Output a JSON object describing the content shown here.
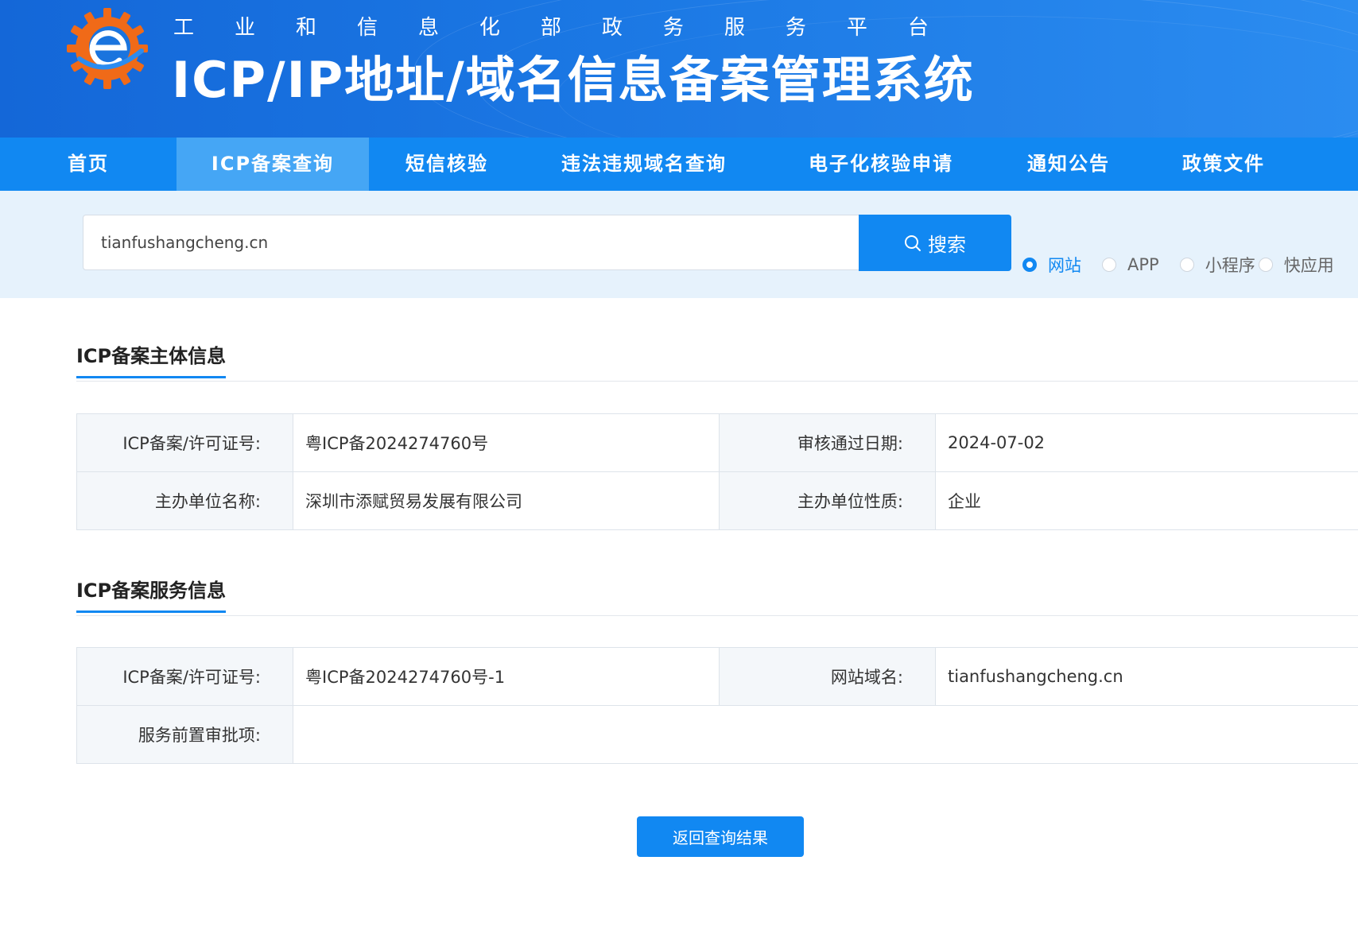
{
  "header": {
    "subtitle_chars": [
      "工",
      "业",
      "和",
      "信",
      "息",
      "化",
      "部",
      "政",
      "务",
      "服",
      "务",
      "平",
      "台"
    ],
    "title": "ICP/IP地址/域名信息备案管理系统",
    "logo_icon": "emblem-gear-e-icon"
  },
  "nav": {
    "items": [
      {
        "label": "首页",
        "active": false
      },
      {
        "label": "ICP备案查询",
        "active": true
      },
      {
        "label": "短信核验",
        "active": false
      },
      {
        "label": "违法违规域名查询",
        "active": false
      },
      {
        "label": "电子化核验申请",
        "active": false
      },
      {
        "label": "通知公告",
        "active": false
      },
      {
        "label": "政策文件",
        "active": false
      }
    ]
  },
  "search": {
    "value": "tianfushangcheng.cn",
    "button_label": "搜索",
    "button_icon": "search-icon",
    "types": [
      {
        "label": "网站",
        "checked": true
      },
      {
        "label": "APP",
        "checked": false
      },
      {
        "label": "小程序",
        "checked": false
      },
      {
        "label": "快应用",
        "checked": false
      }
    ]
  },
  "subject_info": {
    "title": "ICP备案主体信息",
    "license_label": "ICP备案/许可证号:",
    "license_value": "粤ICP备2024274760号",
    "approve_date_label": "审核通过日期:",
    "approve_date_value": "2024-07-02",
    "org_name_label": "主办单位名称:",
    "org_name_value": "深圳市添赋贸易发展有限公司",
    "org_type_label": "主办单位性质:",
    "org_type_value": "企业"
  },
  "service_info": {
    "title": "ICP备案服务信息",
    "license_label": "ICP备案/许可证号:",
    "license_value": "粤ICP备2024274760号-1",
    "domain_label": "网站域名:",
    "domain_value": "tianfushangcheng.cn",
    "pre_approval_label": "服务前置审批项:",
    "pre_approval_value": ""
  },
  "back_button_label": "返回查询结果",
  "colors": {
    "primary": "#1188f2",
    "nav_active": "#45a6f5",
    "search_band": "#e6f2fc",
    "logo_orange": "#f06a18"
  }
}
